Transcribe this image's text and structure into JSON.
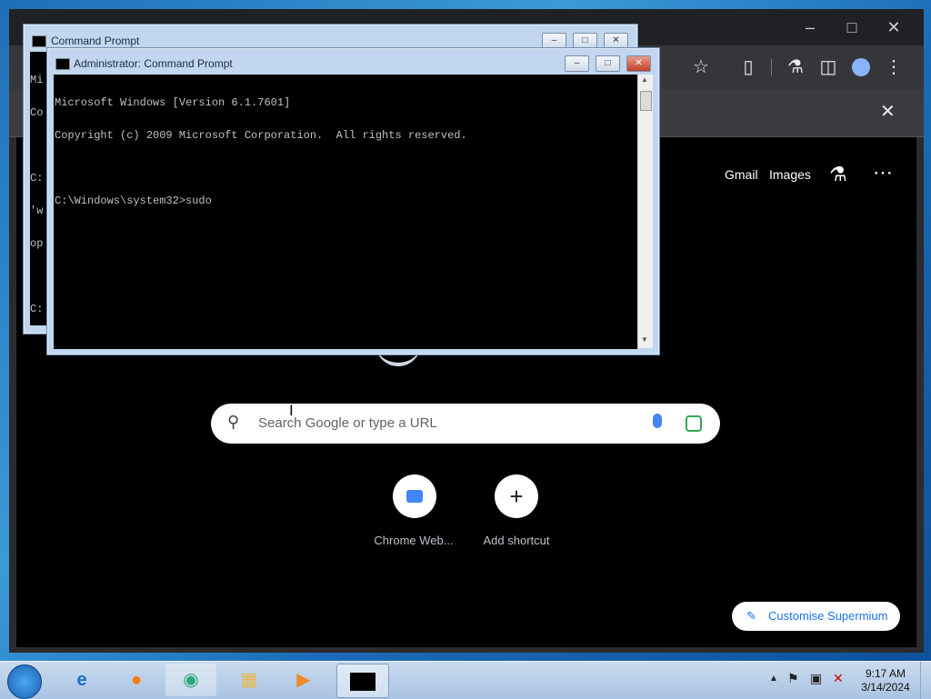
{
  "chrome": {
    "toplinks": {
      "gmail": "Gmail",
      "images": "Images"
    },
    "search": {
      "placeholder": "Search Google or type a URL"
    },
    "shortcuts": [
      {
        "label": "Chrome Web..."
      },
      {
        "label": "Add shortcut"
      }
    ],
    "customise_label": "Customise Supermium"
  },
  "cmd_back": {
    "title": "Command Prompt",
    "lines": [
      "Mi",
      "Co",
      "",
      "C:",
      "'w",
      "op",
      "",
      "C:"
    ]
  },
  "cmd_front": {
    "title": "Administrator: Command Prompt",
    "lines": [
      "Microsoft Windows [Version 6.1.7601]",
      "Copyright (c) 2009 Microsoft Corporation.  All rights reserved.",
      "",
      "C:\\Windows\\system32>sudo"
    ]
  },
  "taskbar": {
    "clock": {
      "time": "9:17 AM",
      "date": "3/14/2024"
    }
  },
  "colors": {
    "accent": "#1a73e8",
    "desktop": "#1e6fb8"
  }
}
